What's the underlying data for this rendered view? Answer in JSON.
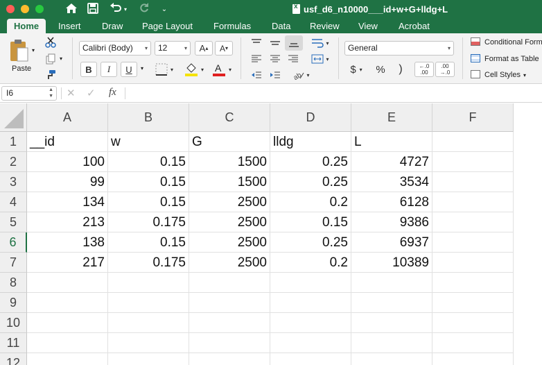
{
  "app": {
    "doc_title": "usf_d6_n10000___id+w+G+lldg+L",
    "accent": "#1f7244"
  },
  "tabs": [
    "Home",
    "Insert",
    "Draw",
    "Page Layout",
    "Formulas",
    "Data",
    "Review",
    "View",
    "Acrobat"
  ],
  "ribbon": {
    "paste_label": "Paste",
    "font_name": "Calibri (Body)",
    "font_size": "12",
    "number_format": "General",
    "conditional_formatting": "Conditional Formatting",
    "format_as_table": "Format as Table",
    "cell_styles": "Cell Styles",
    "percent_symbol": "%",
    "currency_symbol": "$",
    "comma_symbol": ")",
    "bold": "B",
    "italic": "I",
    "underline": "U",
    "increase_decimal": "←.0 .00",
    "decrease_decimal": ".00 →.0"
  },
  "formula_bar": {
    "name_box": "I6",
    "fx": "fx",
    "value": ""
  },
  "sheet": {
    "columns": [
      "A",
      "B",
      "C",
      "D",
      "E",
      "F"
    ],
    "rows": [
      "1",
      "2",
      "3",
      "4",
      "5",
      "6",
      "7",
      "8",
      "9",
      "10",
      "11",
      "12"
    ],
    "selected_row": "6",
    "data": [
      [
        "__id",
        "w",
        "G",
        "lldg",
        "L",
        ""
      ],
      [
        "100",
        "0.15",
        "1500",
        "0.25",
        "4727",
        ""
      ],
      [
        "99",
        "0.15",
        "1500",
        "0.25",
        "3534",
        ""
      ],
      [
        "134",
        "0.15",
        "2500",
        "0.2",
        "6128",
        ""
      ],
      [
        "213",
        "0.175",
        "2500",
        "0.15",
        "9386",
        ""
      ],
      [
        "138",
        "0.15",
        "2500",
        "0.25",
        "6937",
        ""
      ],
      [
        "217",
        "0.175",
        "2500",
        "0.2",
        "10389",
        ""
      ]
    ]
  }
}
